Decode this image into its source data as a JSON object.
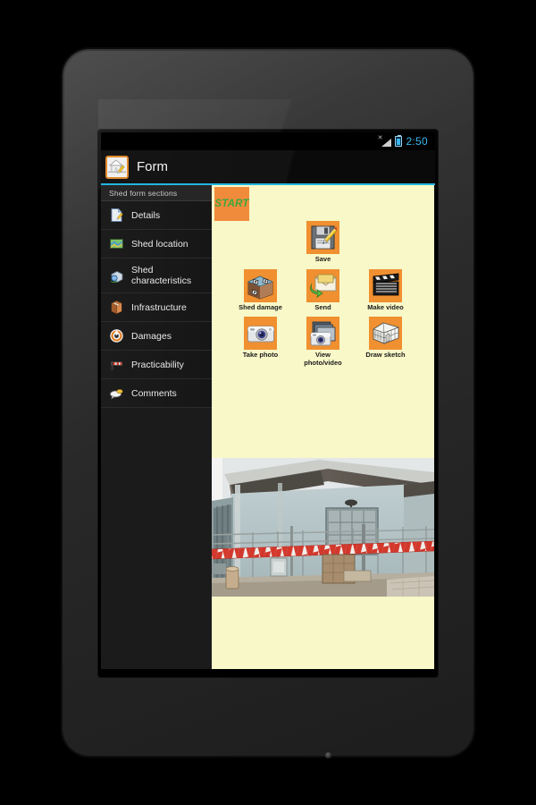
{
  "device": {
    "name": "android-tablet"
  },
  "statusbar": {
    "signal_icon": "signal-bars-icon",
    "battery_icon": "battery-icon",
    "clock": "2:50"
  },
  "actionbar": {
    "app_icon": "house-with-pencil-icon",
    "title": "Form"
  },
  "colors": {
    "accent_line": "#22b6e0",
    "paper_background": "#f8f8c8",
    "tile_orange": "#f09030",
    "start_orange": "#f08b3c",
    "start_text_green": "#3ca83c",
    "clock_blue": "#3bb9f0",
    "sidebar_background": "#1b1b1b"
  },
  "sidebar": {
    "header": "Shed form sections",
    "items": [
      {
        "label": "Details",
        "icon": "document-page-icon"
      },
      {
        "label": "Shed location",
        "icon": "map-icon"
      },
      {
        "label": "Shed characteristics",
        "icon": "building-globe-icon"
      },
      {
        "label": "Infrastructure",
        "icon": "package-box-icon"
      },
      {
        "label": "Damages",
        "icon": "damage-target-icon"
      },
      {
        "label": "Practicability",
        "icon": "road-barrier-icon"
      },
      {
        "label": "Comments",
        "icon": "speech-comment-icon"
      }
    ]
  },
  "main": {
    "start_button": "START",
    "tiles": [
      [
        {
          "label": "Save",
          "icon": "floppy-disk-pencil-icon"
        }
      ],
      [
        {
          "label": "Shed damage",
          "icon": "damaged-shed-icon"
        },
        {
          "label": "Send",
          "icon": "envelope-send-icon"
        },
        {
          "label": "Make video",
          "icon": "clapperboard-icon"
        }
      ],
      [
        {
          "label": "Take photo",
          "icon": "camera-icon"
        },
        {
          "label": "View photo/video",
          "icon": "photo-stack-icon"
        },
        {
          "label": "Draw sketch",
          "icon": "sketch-building-icon"
        }
      ]
    ],
    "photo": {
      "name": "damaged-shed-photograph",
      "description": "Damaged light-blue industrial shed with red and white hazard tape"
    }
  }
}
